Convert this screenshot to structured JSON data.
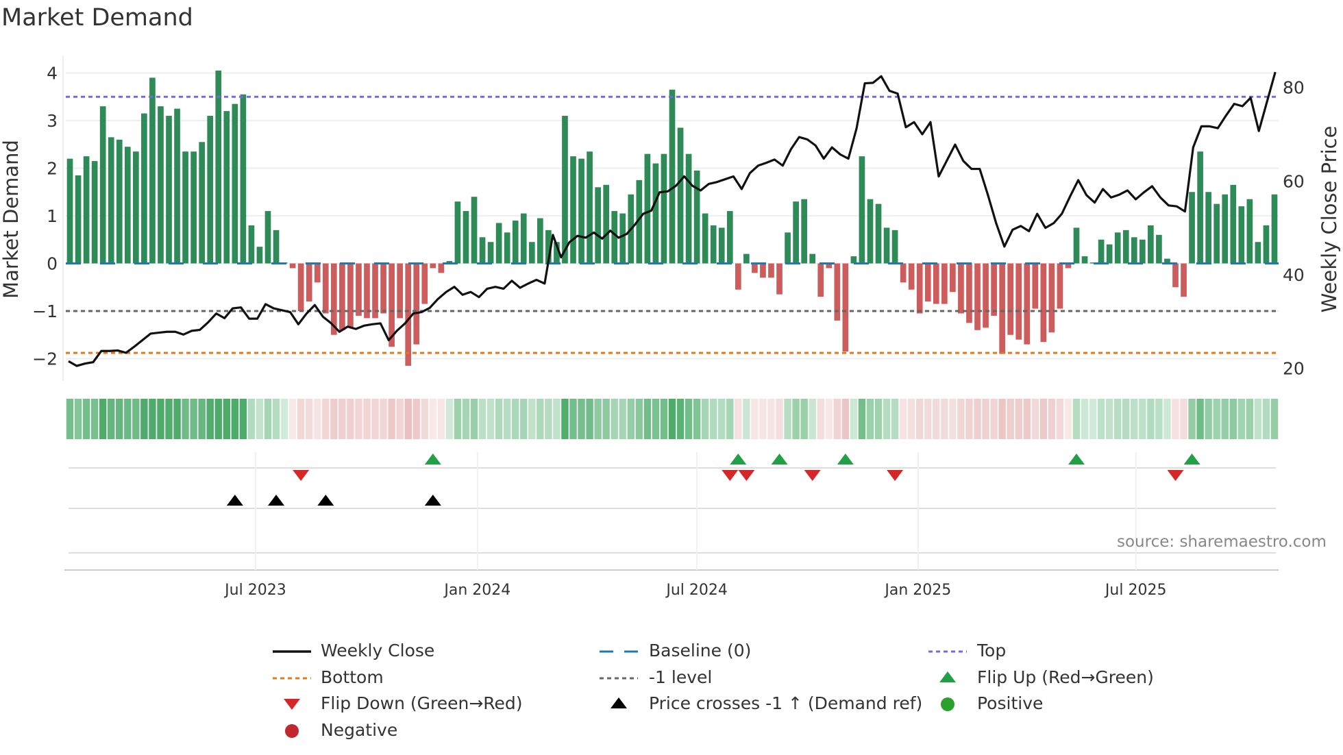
{
  "chart_data": {
    "type": "bar",
    "title": "Market Demand",
    "ylabel": "Market Demand",
    "y2label": "Weekly Close Price",
    "ylim": [
      -2.4,
      4.4
    ],
    "y2lim": [
      17,
      86
    ],
    "yticks": [
      {
        "v": 4,
        "label": "4"
      },
      {
        "v": 3,
        "label": "3"
      },
      {
        "v": 2,
        "label": "2"
      },
      {
        "v": 1,
        "label": "1"
      },
      {
        "v": 0,
        "label": "0"
      },
      {
        "v": -1,
        "label": "−1"
      },
      {
        "v": -2,
        "label": "−2"
      }
    ],
    "y2ticks": [
      {
        "v": 80,
        "label": "80"
      },
      {
        "v": 60,
        "label": "60"
      },
      {
        "v": 40,
        "label": "40"
      },
      {
        "v": 20,
        "label": "20"
      }
    ],
    "xticks": [
      {
        "i": 22.5,
        "label": "Jul 2023"
      },
      {
        "i": 49.4,
        "label": "Jan 2024"
      },
      {
        "i": 76,
        "label": "Jul 2024"
      },
      {
        "i": 102.8,
        "label": "Jan 2025"
      },
      {
        "i": 129.2,
        "label": "Jul 2025"
      }
    ],
    "levels": {
      "top": 3.5,
      "bottom": -1.88,
      "minus_one": -1,
      "baseline": 0
    },
    "demand": [
      2.2,
      1.85,
      2.25,
      2.15,
      3.3,
      2.65,
      2.6,
      2.45,
      2.35,
      3.15,
      3.9,
      3.3,
      3.1,
      3.25,
      2.35,
      2.35,
      2.55,
      3.1,
      4.05,
      3.2,
      3.35,
      3.55,
      0.8,
      0.35,
      1.1,
      0.7,
      0.02,
      -0.1,
      -1.0,
      -0.8,
      -0.4,
      -1.05,
      -1.5,
      -1.4,
      -1.35,
      -1.1,
      -1.15,
      -1.15,
      -1.05,
      -1.75,
      -1.15,
      -2.15,
      -1.7,
      -0.85,
      -0.1,
      -0.2,
      0.05,
      1.3,
      1.1,
      1.4,
      0.55,
      0.45,
      0.85,
      0.65,
      0.9,
      1.05,
      0.45,
      0.95,
      0.7,
      0.45,
      3.1,
      2.25,
      2.2,
      2.35,
      1.6,
      1.65,
      1.1,
      1.05,
      1.45,
      1.75,
      2.3,
      2.1,
      2.3,
      3.65,
      2.85,
      2.3,
      1.95,
      1.05,
      0.8,
      0.75,
      1.1,
      -0.55,
      0.2,
      -0.2,
      -0.3,
      -0.3,
      -0.65,
      0.65,
      1.3,
      1.35,
      0.2,
      -0.7,
      -0.1,
      -1.2,
      -1.85,
      0.15,
      2.25,
      1.35,
      1.25,
      0.75,
      0.7,
      -0.4,
      -0.55,
      -1.05,
      -0.8,
      -0.85,
      -0.85,
      -0.6,
      -1.05,
      -1.25,
      -1.4,
      -1.35,
      -1.1,
      -1.9,
      -1.5,
      -1.6,
      -1.7,
      -0.95,
      -1.65,
      -1.45,
      -0.95,
      -0.1,
      0.75,
      0.15,
      0.02,
      0.5,
      0.4,
      0.65,
      0.7,
      0.55,
      0.5,
      0.8,
      0.6,
      0.1,
      -0.5,
      -0.7,
      1.5,
      2.35,
      1.5,
      1.25,
      1.45,
      1.65,
      1.2,
      1.35,
      0.45,
      0.8,
      1.45
    ],
    "price": [
      21.5,
      20.5,
      21,
      21.3,
      23.7,
      23.7,
      23.8,
      23.3,
      24.6,
      26,
      27.4,
      27.6,
      27.8,
      27.8,
      27.2,
      28,
      28.2,
      29.8,
      31.7,
      30.7,
      32.8,
      33,
      30.6,
      30.6,
      33.7,
      32.8,
      32.4,
      32,
      29.4,
      31.7,
      33.5,
      31,
      29.6,
      27.8,
      28.9,
      28.4,
      29.1,
      29.4,
      29.6,
      26,
      28,
      29.6,
      31.7,
      32,
      32.9,
      34.8,
      36.3,
      37.4,
      35.7,
      36.3,
      35.2,
      37,
      37.4,
      37,
      38.7,
      37.2,
      38.1,
      38.9,
      38.1,
      48.5,
      43.7,
      46.9,
      48.3,
      47.9,
      49,
      47.7,
      49.4,
      47.9,
      48.7,
      50.7,
      53,
      53.7,
      57.6,
      57.8,
      59,
      61,
      59,
      58,
      59.4,
      59.8,
      60.4,
      61,
      58.3,
      61.7,
      63.3,
      63.9,
      64.6,
      63.3,
      66.8,
      69.4,
      68.9,
      67.6,
      64.8,
      67.2,
      65.7,
      64.8,
      71.3,
      80.9,
      81,
      82.4,
      79.3,
      78.7,
      71.5,
      72.6,
      70,
      72.6,
      61,
      64.4,
      67.8,
      64.3,
      62.6,
      62.6,
      57,
      51,
      46,
      49.6,
      50.4,
      49.3,
      53,
      50,
      51,
      53,
      56.7,
      60.2,
      57,
      55.4,
      58.3,
      56.5,
      57.1,
      58,
      56.1,
      57.6,
      58.9,
      56.5,
      54.8,
      54.6,
      53.5,
      67.2,
      71.7,
      71.7,
      71.3,
      74,
      76.5,
      76,
      77.8,
      70.7,
      77,
      83.3
    ],
    "flip_up": [
      44,
      81,
      86,
      94,
      122,
      136
    ],
    "flip_down": [
      28,
      80,
      82,
      90,
      100,
      134
    ],
    "price_cross": [
      20,
      25,
      31,
      44
    ],
    "legend": [
      {
        "label": "Weekly Close",
        "kind": "line",
        "color": "#111111"
      },
      {
        "label": "Baseline (0)",
        "kind": "dash",
        "color": "#1f77b4"
      },
      {
        "label": "Top",
        "kind": "dot",
        "color": "#7b68d8"
      },
      {
        "label": "Bottom",
        "kind": "dot",
        "color": "#e07b10"
      },
      {
        "label": "-1 level",
        "kind": "dot",
        "color": "#666666"
      },
      {
        "label": "Flip Up (Red→Green)",
        "kind": "tri-up",
        "color": "#22a045"
      },
      {
        "label": "Flip Down (Green→Red)",
        "kind": "tri-down",
        "color": "#d62728"
      },
      {
        "label": "Price crosses -1 ↑ (Demand ref)",
        "kind": "tri-up",
        "color": "#000000"
      },
      {
        "label": "Positive",
        "kind": "circle",
        "color": "#2ca02c"
      },
      {
        "label": "Negative",
        "kind": "circle",
        "color": "#c0282d"
      }
    ],
    "colors": {
      "pos": "#2e8b57",
      "neg": "#cd5c5c"
    }
  },
  "source": "source: sharemaestro.com"
}
